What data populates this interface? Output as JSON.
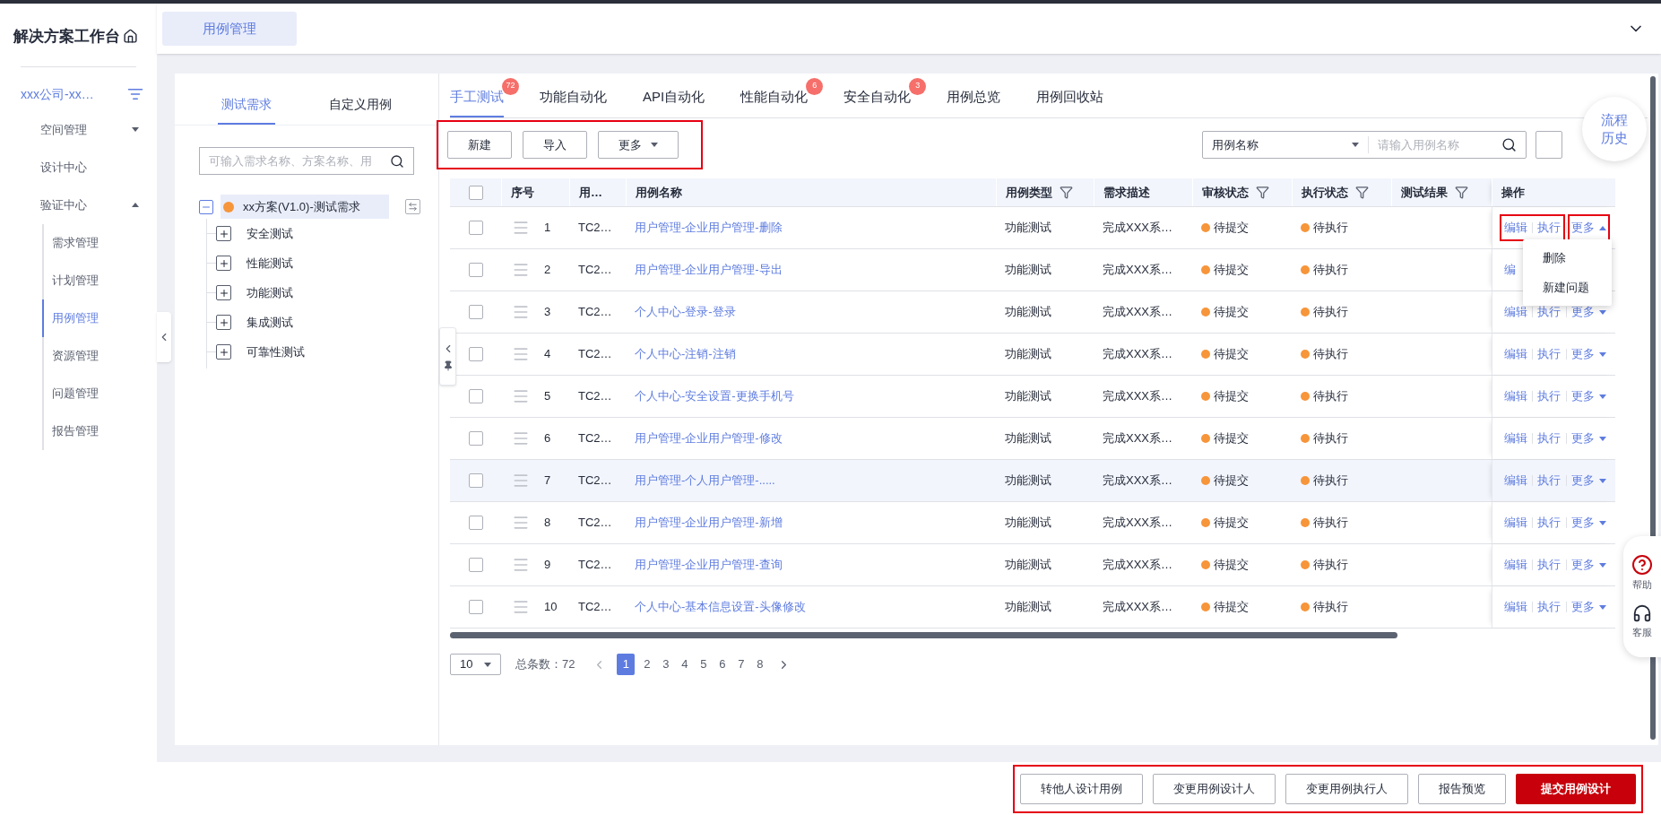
{
  "sidebar": {
    "title": "解决方案工作台",
    "project": "xxx公司-xx…",
    "items": [
      {
        "label": "空间管理",
        "expanded": false,
        "selected": false
      },
      {
        "label": "设计中心",
        "selected": false
      },
      {
        "label": "验证中心",
        "expanded": true,
        "selected": false,
        "children": [
          {
            "label": "需求管理",
            "selected": false
          },
          {
            "label": "计划管理",
            "selected": false
          },
          {
            "label": "用例管理",
            "selected": true
          },
          {
            "label": "资源管理",
            "selected": false
          },
          {
            "label": "问题管理",
            "selected": false
          },
          {
            "label": "报告管理",
            "selected": false
          }
        ]
      }
    ]
  },
  "page_tabs": [
    {
      "label": "用例管理",
      "selected": true
    }
  ],
  "tree_panel": {
    "tabs": [
      {
        "label": "测试需求",
        "selected": true
      },
      {
        "label": "自定义用例",
        "selected": false
      }
    ],
    "search": {
      "placeholder": "可输入需求名称、方案名称、用"
    },
    "tree": [
      {
        "label": "xx方案(V1.0)-测试需求",
        "expanded": true,
        "selected": true,
        "children": [
          {
            "label": "安全测试",
            "expanded": false,
            "selected": false
          },
          {
            "label": "性能测试",
            "expanded": false,
            "selected": false
          },
          {
            "label": "功能测试",
            "expanded": false,
            "selected": false
          },
          {
            "label": "集成测试",
            "expanded": false,
            "selected": false
          },
          {
            "label": "可靠性测试",
            "expanded": false,
            "selected": false
          }
        ]
      }
    ]
  },
  "tabs": [
    {
      "label": "手工测试",
      "selected": true,
      "badge": "72"
    },
    {
      "label": "功能自动化",
      "selected": false
    },
    {
      "label": "API自动化",
      "selected": false
    },
    {
      "label": "性能自动化",
      "selected": false,
      "badge": "6"
    },
    {
      "label": "安全自动化",
      "selected": false,
      "badge": "3"
    },
    {
      "label": "用例总览",
      "selected": false
    },
    {
      "label": "用例回收站",
      "selected": false
    }
  ],
  "toolbar": {
    "highlighted": true,
    "buttons": [
      {
        "label": "新建",
        "kind": "button"
      },
      {
        "label": "导入",
        "kind": "button"
      },
      {
        "label": "更多",
        "kind": "dropdown"
      }
    ],
    "search": {
      "field": "用例名称",
      "placeholder": "请输入用例名称"
    }
  },
  "flow_history": "流程历史",
  "table": {
    "columns": [
      {
        "kind": "checkbox",
        "checked": false
      },
      {
        "label": "序号",
        "filter": false
      },
      {
        "label": "用…",
        "filter": false
      },
      {
        "label": "用例名称",
        "filter": false
      },
      {
        "label": "用例类型",
        "filter": true
      },
      {
        "label": "需求描述",
        "filter": false
      },
      {
        "label": "审核状态",
        "filter": true
      },
      {
        "label": "执行状态",
        "filter": true
      },
      {
        "label": "测试结果",
        "filter": true
      },
      {
        "label": "操作",
        "filter": false
      }
    ],
    "rows": [
      {
        "checked": false,
        "no": "1",
        "code": "TC2…",
        "name": "用户管理-企业用户管理-删除",
        "type": "功能测试",
        "description": "完成XXX系…",
        "review": "待提交",
        "execution": "待执行",
        "hovered": false,
        "highlighted": true,
        "menu": [
          "删除",
          "新建问题"
        ],
        "actions": [
          {
            "label": "编辑",
            "kind": "link"
          },
          {
            "label": "执行",
            "kind": "link"
          },
          {
            "label": "更多",
            "kind": "dropdown"
          }
        ]
      },
      {
        "checked": false,
        "no": "2",
        "code": "TC2…",
        "name": "用户管理-企业用户管理-导出",
        "type": "功能测试",
        "description": "完成XXX系…",
        "review": "待提交",
        "execution": "待执行",
        "hovered": false,
        "highlighted": false,
        "actions": [
          {
            "label": "编",
            "kind": "link"
          }
        ]
      },
      {
        "checked": false,
        "no": "3",
        "code": "TC2…",
        "name": "个人中心-登录-登录",
        "type": "功能测试",
        "description": "完成XXX系…",
        "review": "待提交",
        "execution": "待执行",
        "hovered": false,
        "highlighted": false,
        "actions": [
          {
            "label": "编辑",
            "kind": "link"
          },
          {
            "label": "执行",
            "kind": "link"
          },
          {
            "label": "更多",
            "kind": "dropdown"
          }
        ]
      },
      {
        "checked": false,
        "no": "4",
        "code": "TC2…",
        "name": "个人中心-注销-注销",
        "type": "功能测试",
        "description": "完成XXX系…",
        "review": "待提交",
        "execution": "待执行",
        "hovered": false,
        "highlighted": false,
        "actions": [
          {
            "label": "编辑",
            "kind": "link"
          },
          {
            "label": "执行",
            "kind": "link"
          },
          {
            "label": "更多",
            "kind": "dropdown"
          }
        ]
      },
      {
        "checked": false,
        "no": "5",
        "code": "TC2…",
        "name": "个人中心-安全设置-更换手机号",
        "type": "功能测试",
        "description": "完成XXX系…",
        "review": "待提交",
        "execution": "待执行",
        "hovered": false,
        "highlighted": false,
        "actions": [
          {
            "label": "编辑",
            "kind": "link"
          },
          {
            "label": "执行",
            "kind": "link"
          },
          {
            "label": "更多",
            "kind": "dropdown"
          }
        ]
      },
      {
        "checked": false,
        "no": "6",
        "code": "TC2…",
        "name": "用户管理-企业用户管理-修改",
        "type": "功能测试",
        "description": "完成XXX系…",
        "review": "待提交",
        "execution": "待执行",
        "hovered": false,
        "highlighted": false,
        "actions": [
          {
            "label": "编辑",
            "kind": "link"
          },
          {
            "label": "执行",
            "kind": "link"
          },
          {
            "label": "更多",
            "kind": "dropdown"
          }
        ]
      },
      {
        "checked": false,
        "no": "7",
        "code": "TC2…",
        "name": "用户管理-个人用户管理-.....",
        "type": "功能测试",
        "description": "完成XXX系…",
        "review": "待提交",
        "execution": "待执行",
        "hovered": true,
        "highlighted": false,
        "actions": [
          {
            "label": "编辑",
            "kind": "link"
          },
          {
            "label": "执行",
            "kind": "link"
          },
          {
            "label": "更多",
            "kind": "dropdown"
          }
        ]
      },
      {
        "checked": false,
        "no": "8",
        "code": "TC2…",
        "name": "用户管理-企业用户管理-新增",
        "type": "功能测试",
        "description": "完成XXX系…",
        "review": "待提交",
        "execution": "待执行",
        "hovered": false,
        "highlighted": false,
        "actions": [
          {
            "label": "编辑",
            "kind": "link"
          },
          {
            "label": "执行",
            "kind": "link"
          },
          {
            "label": "更多",
            "kind": "dropdown"
          }
        ]
      },
      {
        "checked": false,
        "no": "9",
        "code": "TC2…",
        "name": "用户管理-企业用户管理-查询",
        "type": "功能测试",
        "description": "完成XXX系…",
        "review": "待提交",
        "execution": "待执行",
        "hovered": false,
        "highlighted": false,
        "actions": [
          {
            "label": "编辑",
            "kind": "link"
          },
          {
            "label": "执行",
            "kind": "link"
          },
          {
            "label": "更多",
            "kind": "dropdown"
          }
        ]
      },
      {
        "checked": false,
        "no": "10",
        "code": "TC2…",
        "name": "个人中心-基本信息设置-头像修改",
        "type": "功能测试",
        "description": "完成XXX系…",
        "review": "待提交",
        "execution": "待执行",
        "hovered": false,
        "highlighted": false,
        "actions": [
          {
            "label": "编辑",
            "kind": "link"
          },
          {
            "label": "执行",
            "kind": "link"
          },
          {
            "label": "更多",
            "kind": "dropdown"
          }
        ]
      }
    ]
  },
  "pagination": {
    "page_size": "10",
    "total": "总条数：72",
    "pages": [
      {
        "label": "1",
        "selected": true
      },
      {
        "label": "2",
        "selected": false
      },
      {
        "label": "3",
        "selected": false
      },
      {
        "label": "4",
        "selected": false
      },
      {
        "label": "5",
        "selected": false
      },
      {
        "label": "6",
        "selected": false
      },
      {
        "label": "7",
        "selected": false
      },
      {
        "label": "8",
        "selected": false
      }
    ]
  },
  "help": [
    {
      "label": "帮助",
      "kind": "help"
    },
    {
      "label": "客服",
      "kind": "service"
    }
  ],
  "footer": {
    "highlighted": true,
    "buttons": [
      {
        "label": "转他人设计用例",
        "kind": "default"
      },
      {
        "label": "变更用例设计人",
        "kind": "default"
      },
      {
        "label": "变更用例执行人",
        "kind": "default"
      },
      {
        "label": "报告预览",
        "kind": "default"
      },
      {
        "label": "提交用例设计",
        "kind": "primary"
      }
    ]
  }
}
